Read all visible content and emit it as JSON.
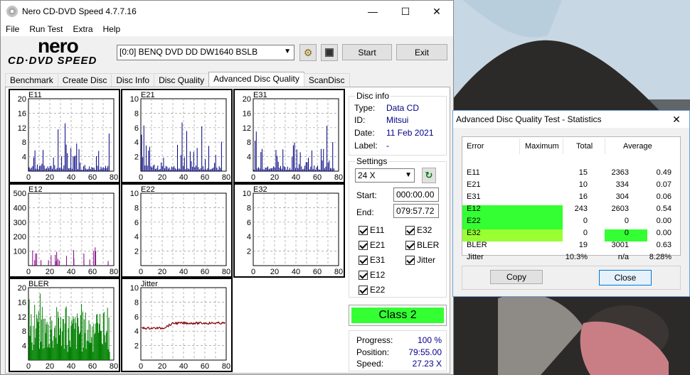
{
  "app": {
    "title": "Nero CD-DVD Speed 4.7.7.16",
    "menu": [
      "File",
      "Run Test",
      "Extra",
      "Help"
    ],
    "logo_top": "nero",
    "logo_bottom": "CD·DVD SPEED"
  },
  "toolbar": {
    "drive": "[0:0]   BENQ DVD DD DW1640 BSLB",
    "start_label": "Start",
    "exit_label": "Exit"
  },
  "tabs": [
    "Benchmark",
    "Create Disc",
    "Disc Info",
    "Disc Quality",
    "Advanced Disc Quality",
    "ScanDisc"
  ],
  "active_tab": "Advanced Disc Quality",
  "disc_info": {
    "title": "Disc info",
    "type_label": "Type:",
    "type": "Data CD",
    "id_label": "ID:",
    "id": "Mitsui",
    "date_label": "Date:",
    "date": "11 Feb 2021",
    "label_label": "Label:",
    "label": "-"
  },
  "settings": {
    "title": "Settings",
    "speed": "24 X",
    "start_label": "Start:",
    "start": "000:00.00",
    "end_label": "End:",
    "end": "079:57.72",
    "checks": {
      "e11": "E11",
      "e21": "E21",
      "e31": "E31",
      "e12": "E12",
      "e22": "E22",
      "e32": "E32",
      "bler": "BLER",
      "jitter": "Jitter"
    }
  },
  "class_label": "Class 2",
  "progress": {
    "progress_label": "Progress:",
    "progress": "100 %",
    "position_label": "Position:",
    "position": "79:55.00",
    "speed_label": "Speed:",
    "speed": "27.23 X"
  },
  "charts": {
    "e11": {
      "label": "E11",
      "yticks": [
        "20",
        "16",
        "12",
        "8",
        "4"
      ],
      "xticks": [
        "0",
        "20",
        "40",
        "60",
        "80"
      ]
    },
    "e21": {
      "label": "E21",
      "yticks": [
        "10",
        "8",
        "6",
        "4",
        "2"
      ],
      "xticks": [
        "0",
        "20",
        "40",
        "60",
        "80"
      ]
    },
    "e31": {
      "label": "E31",
      "yticks": [
        "20",
        "16",
        "12",
        "8",
        "4"
      ],
      "xticks": [
        "0",
        "20",
        "40",
        "60",
        "80"
      ]
    },
    "e12": {
      "label": "E12",
      "yticks": [
        "500",
        "400",
        "300",
        "200",
        "100"
      ],
      "xticks": [
        "0",
        "20",
        "40",
        "60",
        "80"
      ]
    },
    "e22": {
      "label": "E22",
      "yticks": [
        "10",
        "8",
        "6",
        "4",
        "2"
      ],
      "xticks": [
        "0",
        "20",
        "40",
        "60",
        "80"
      ]
    },
    "e32": {
      "label": "E32",
      "yticks": [
        "10",
        "8",
        "6",
        "4",
        "2"
      ],
      "xticks": [
        "0",
        "20",
        "40",
        "60",
        "80"
      ]
    },
    "bler": {
      "label": "BLER",
      "yticks": [
        "20",
        "16",
        "12",
        "8",
        "4"
      ],
      "xticks": [
        "0",
        "20",
        "40",
        "60",
        "80"
      ]
    },
    "jitter": {
      "label": "Jitter",
      "yticks": [
        "10",
        "8",
        "6",
        "4",
        "2"
      ],
      "xticks": [
        "0",
        "20",
        "40",
        "60",
        "80"
      ]
    }
  },
  "stats": {
    "title": "Advanced Disc Quality Test - Statistics",
    "headers": [
      "Error",
      "Maximum",
      "Total",
      "Average"
    ],
    "rows": [
      [
        "E11",
        "15",
        "2363",
        "0.49"
      ],
      [
        "E21",
        "10",
        "334",
        "0.07"
      ],
      [
        "E31",
        "16",
        "304",
        "0.06"
      ],
      [
        "E12",
        "243",
        "2603",
        "0.54"
      ],
      [
        "E22",
        "0",
        "0",
        "0.00"
      ],
      [
        "E32",
        "0",
        "0",
        "0.00"
      ],
      [
        "BLER",
        "19",
        "3001",
        "0.63"
      ],
      [
        "Jitter",
        "10.3%",
        "n/a",
        "8.28%"
      ]
    ],
    "copy_label": "Copy",
    "close_label": "Close"
  },
  "colors": {
    "bar_blue": "#000080",
    "bar_purple": "#800080",
    "bar_green": "#008000",
    "jitter_line": "#800000",
    "class_bg": "#33ff33"
  }
}
